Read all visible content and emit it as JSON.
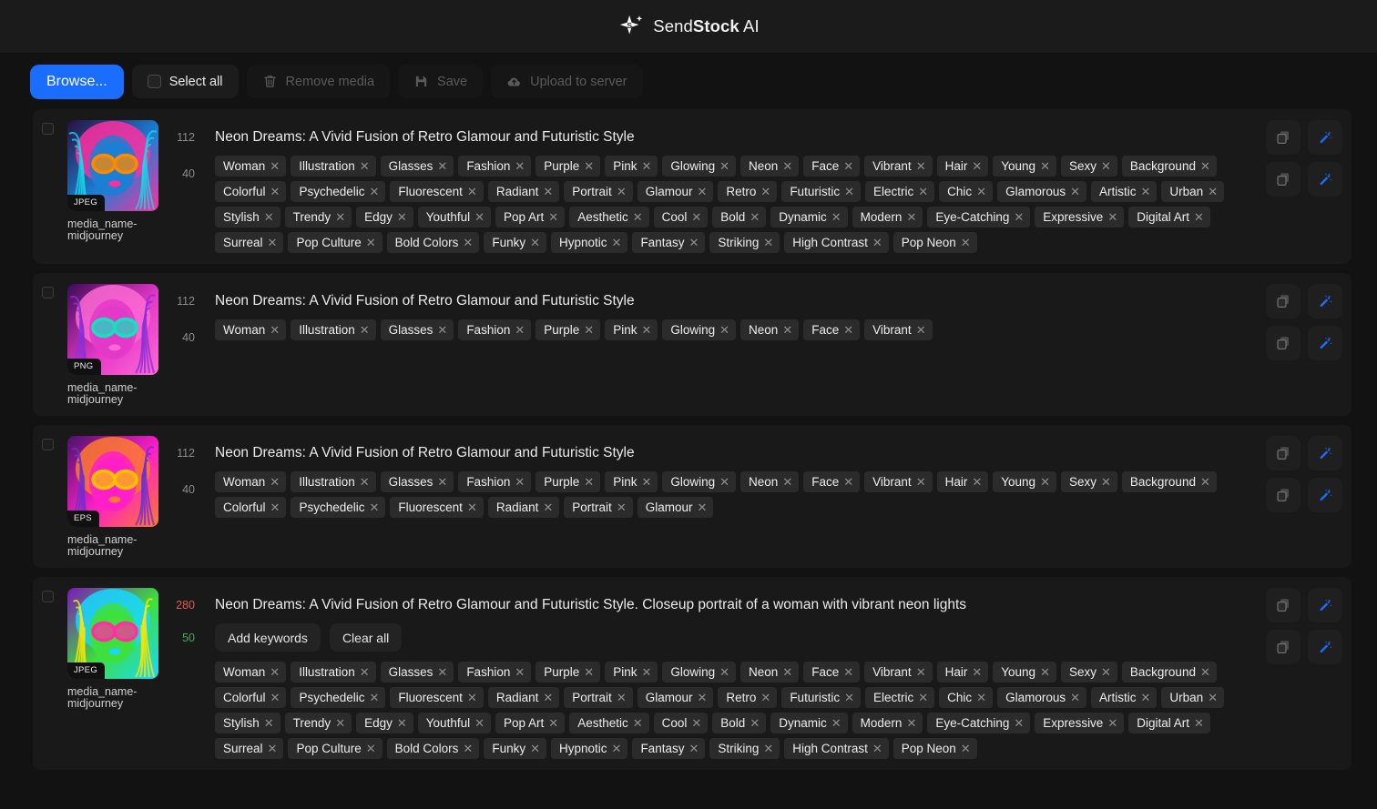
{
  "header": {
    "brand_prefix": "Send",
    "brand_bold": "Stock",
    "brand_suffix": " AI",
    "logo_icon": "sparkle-s-logo"
  },
  "toolbar": {
    "browse_label": "Browse...",
    "select_all_label": "Select all",
    "remove_media_label": "Remove media",
    "remove_media_icon": "trash-icon",
    "save_label": "Save",
    "save_icon": "floppy-disk-icon",
    "upload_label": "Upload to server",
    "upload_icon": "cloud-upload-icon",
    "accent_color": "#1a6dff"
  },
  "icons": {
    "copy": "copy-icon",
    "magic": "magic-wand-icon"
  },
  "tag_sets": {
    "full": [
      "Woman",
      "Illustration",
      "Glasses",
      "Fashion",
      "Purple",
      "Pink",
      "Glowing",
      "Neon",
      "Face",
      "Vibrant",
      "Hair",
      "Young",
      "Sexy",
      "Background",
      "Colorful",
      "Psychedelic",
      "Fluorescent",
      "Radiant",
      "Portrait",
      "Glamour",
      "Retro",
      "Futuristic",
      "Electric",
      "Chic",
      "Glamorous",
      "Artistic",
      "Urban",
      "Stylish",
      "Trendy",
      "Edgy",
      "Youthful",
      "Pop Art",
      "Aesthetic",
      "Cool",
      "Bold",
      "Dynamic",
      "Modern",
      "Eye-Catching",
      "Expressive",
      "Digital Art",
      "Surreal",
      "Pop Culture",
      "Bold Colors",
      "Funky",
      "Hypnotic",
      "Fantasy",
      "Striking",
      "High Contrast",
      "Pop Neon"
    ],
    "short": [
      "Woman",
      "Illustration",
      "Glasses",
      "Fashion",
      "Purple",
      "Pink",
      "Glowing",
      "Neon",
      "Face",
      "Vibrant"
    ],
    "medium": [
      "Woman",
      "Illustration",
      "Glasses",
      "Fashion",
      "Purple",
      "Pink",
      "Glowing",
      "Neon",
      "Face",
      "Vibrant",
      "Hair",
      "Young",
      "Sexy",
      "Background",
      "Colorful",
      "Psychedelic",
      "Fluorescent",
      "Radiant",
      "Portrait",
      "Glamour"
    ]
  },
  "rows": [
    {
      "format": "JPEG",
      "media_name_line1": "media_name-",
      "media_name_line2": "midjourney",
      "title_count": "112",
      "title_count_state": "normal",
      "tag_count": "40",
      "tag_count_state": "normal",
      "title": "Neon Dreams: A Vivid Fusion of Retro Glamour and Futuristic Style",
      "tag_set": "full",
      "show_keyword_buttons": false,
      "thumb_palette": [
        "#2a1040",
        "#1b7fd4",
        "#ff8a00",
        "#ff2fa0",
        "#16d6e6"
      ],
      "thumb_variant": 0
    },
    {
      "format": "PNG",
      "media_name_line1": "media_name-",
      "media_name_line2": "midjourney",
      "title_count": "112",
      "title_count_state": "normal",
      "tag_count": "40",
      "tag_count_state": "normal",
      "title": "Neon Dreams: A Vivid Fusion of Retro Glamour and Futuristic Style",
      "tag_set": "short",
      "show_keyword_buttons": false,
      "thumb_palette": [
        "#3d0a55",
        "#e438c8",
        "#17e0c0",
        "#ff6ad5",
        "#8b2fd6"
      ],
      "thumb_variant": 1
    },
    {
      "format": "EPS",
      "media_name_line1": "media_name-",
      "media_name_line2": "midjourney",
      "title_count": "112",
      "title_count_state": "normal",
      "tag_count": "40",
      "tag_count_state": "normal",
      "title": "Neon Dreams: A Vivid Fusion of Retro Glamour and Futuristic Style",
      "tag_set": "medium",
      "show_keyword_buttons": false,
      "thumb_palette": [
        "#4a1268",
        "#ff1fc8",
        "#ffc200",
        "#ff7a2f",
        "#6a2fd0"
      ],
      "thumb_variant": 2
    },
    {
      "format": "JPEG",
      "media_name_line1": "media_name-",
      "media_name_line2": "midjourney",
      "title_count": "280",
      "title_count_state": "over",
      "tag_count": "50",
      "tag_count_state": "ok",
      "title": "Neon Dreams: A Vivid Fusion of Retro Glamour and Futuristic Style. Closeup portrait of a woman with vibrant neon lights",
      "tag_set": "full",
      "show_keyword_buttons": true,
      "add_keywords_label": "Add keywords",
      "clear_all_label": "Clear all",
      "thumb_palette": [
        "#7a18b8",
        "#3de03d",
        "#ff2fa0",
        "#18d8ff",
        "#ffe600"
      ],
      "thumb_variant": 3
    }
  ]
}
